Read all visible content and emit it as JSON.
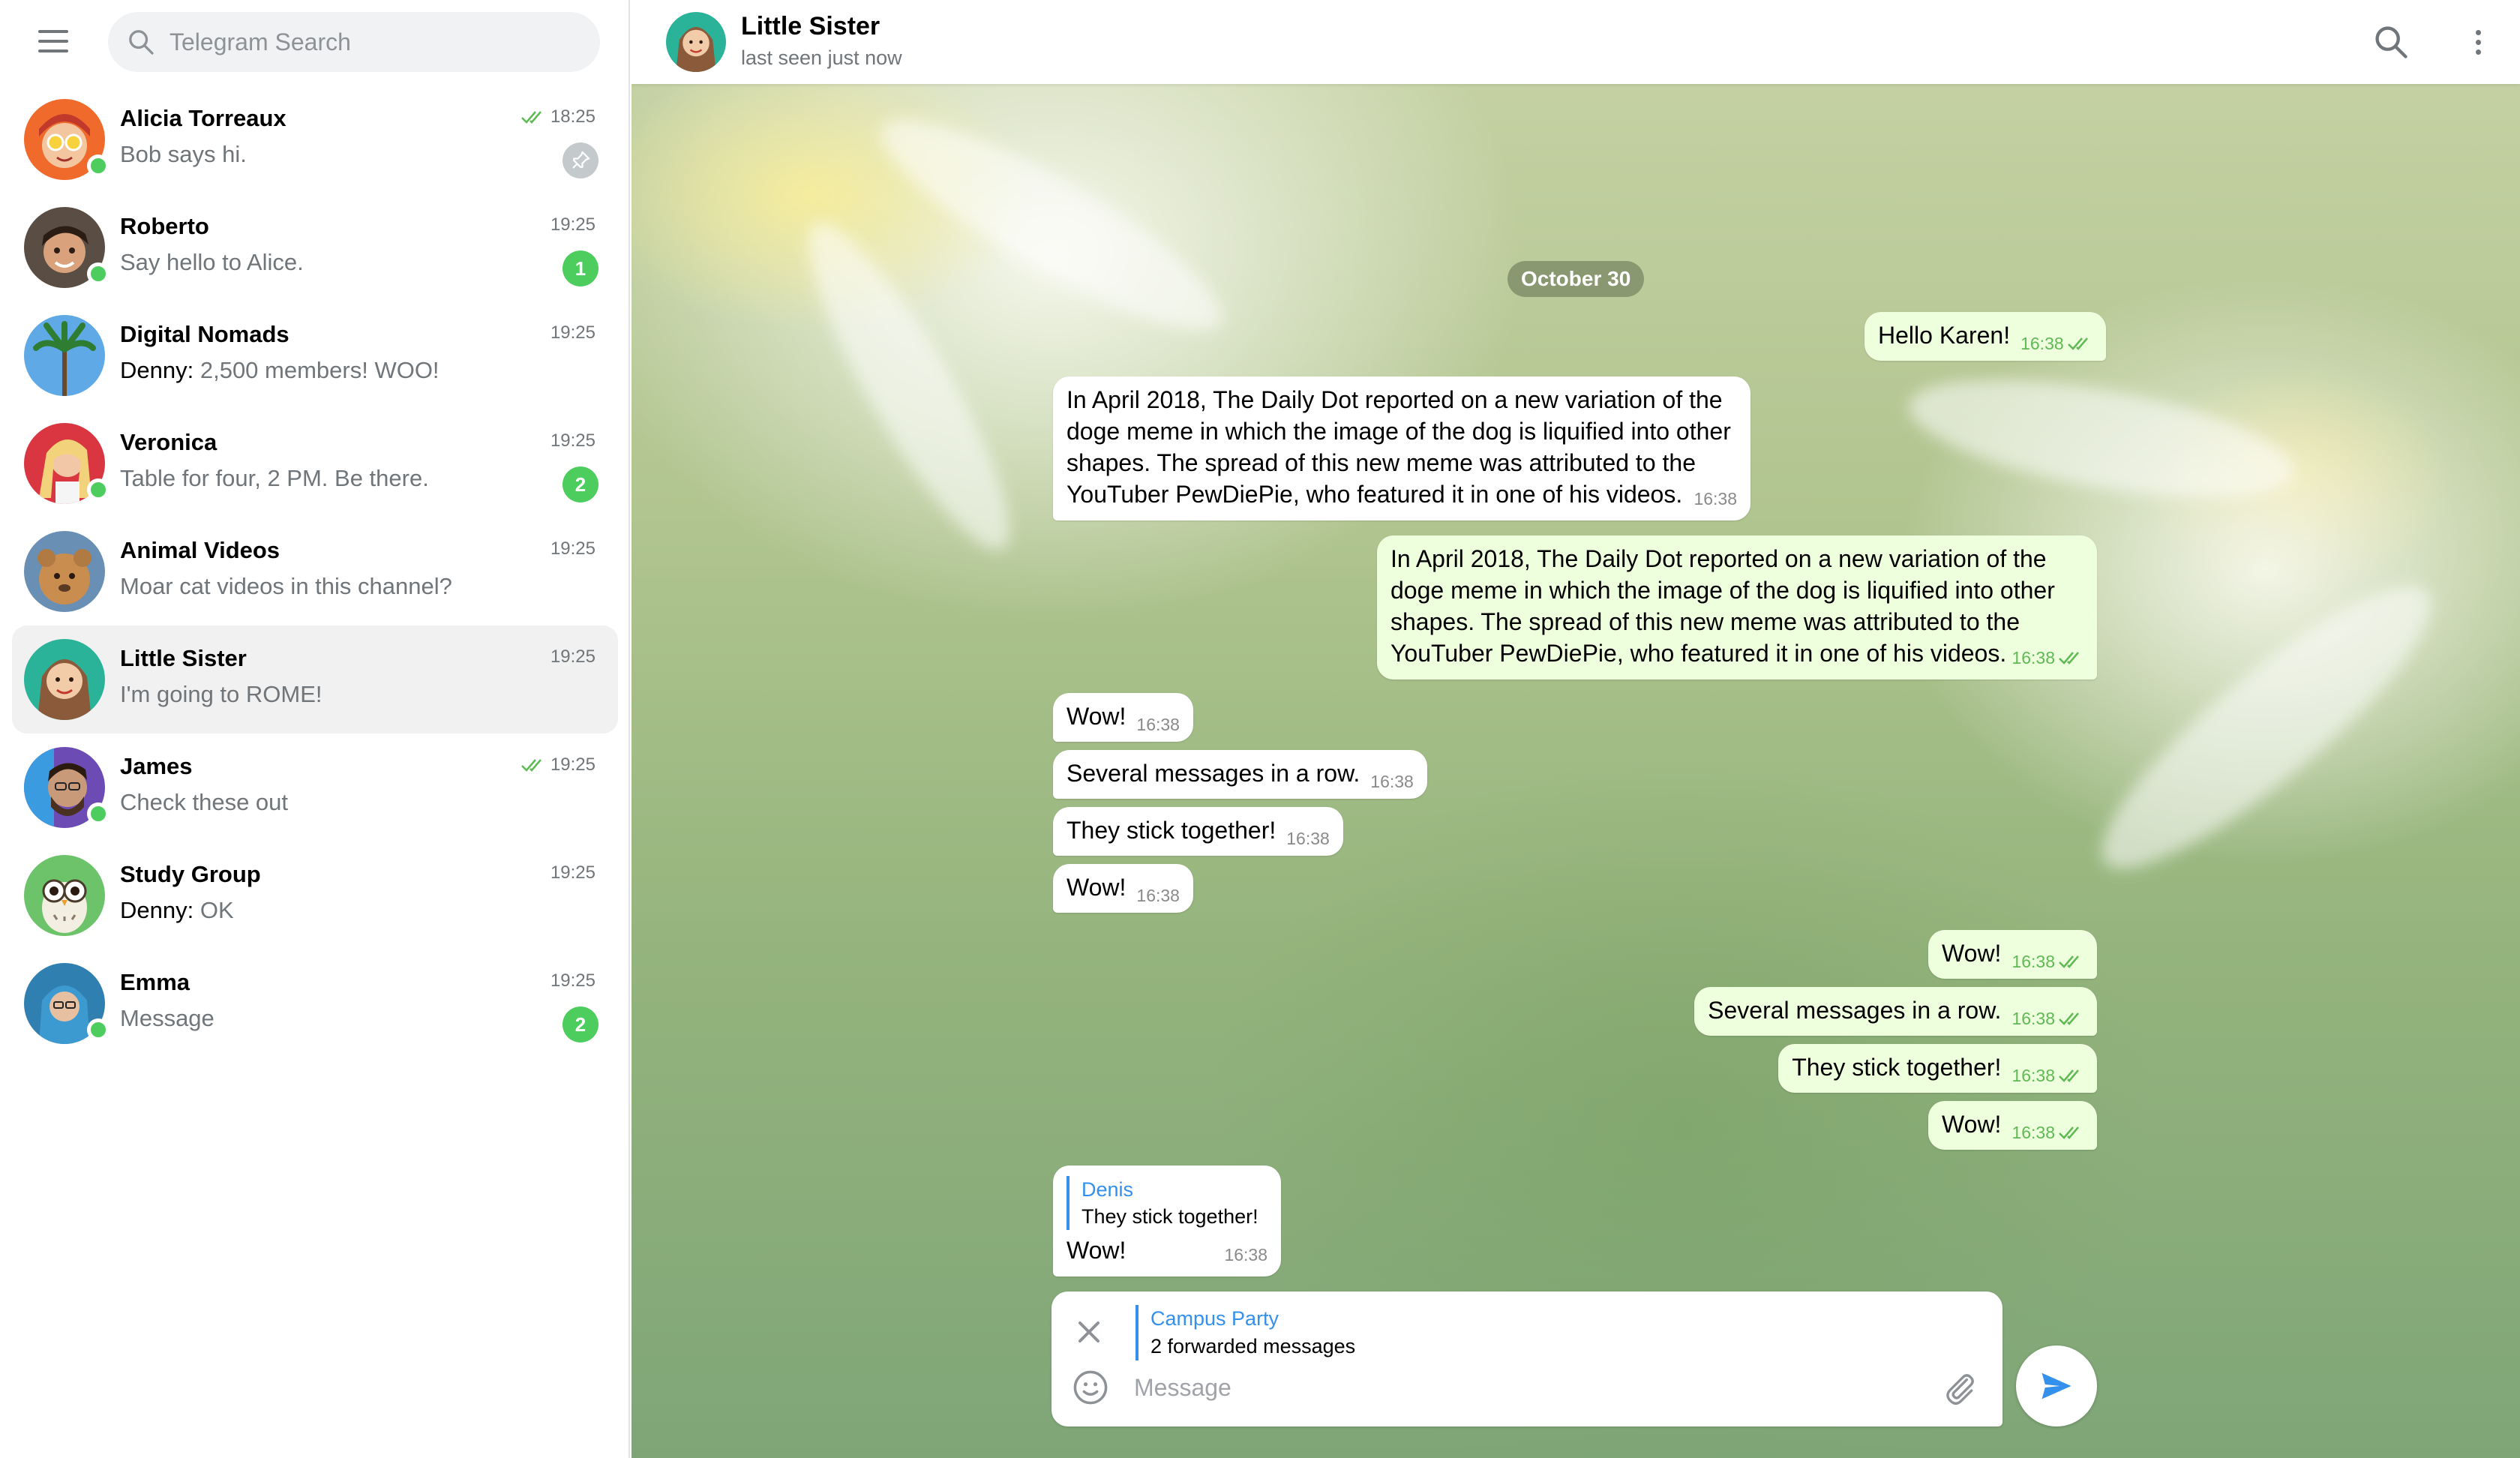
{
  "search": {
    "placeholder": "Telegram Search"
  },
  "chats": [
    {
      "name": "Alicia Torreaux",
      "sender": "",
      "preview": "Bob says hi.",
      "time": "18:25",
      "read": true,
      "pinned": true,
      "badge": "",
      "online": true
    },
    {
      "name": "Roberto",
      "sender": "",
      "preview": "Say hello to Alice.",
      "time": "19:25",
      "read": false,
      "pinned": false,
      "badge": "1",
      "online": true
    },
    {
      "name": "Digital Nomads",
      "sender": "Denny: ",
      "preview": "2,500 members! WOO!",
      "time": "19:25",
      "read": false,
      "pinned": false,
      "badge": "",
      "online": false
    },
    {
      "name": "Veronica",
      "sender": "",
      "preview": "Table for four, 2 PM. Be there.",
      "time": "19:25",
      "read": false,
      "pinned": false,
      "badge": "2",
      "online": true
    },
    {
      "name": "Animal Videos",
      "sender": "",
      "preview": "Moar cat videos in this channel?",
      "time": "19:25",
      "read": false,
      "pinned": false,
      "badge": "",
      "online": false
    },
    {
      "name": "Little Sister",
      "sender": "",
      "preview": "I'm going to ROME!",
      "time": "19:25",
      "read": false,
      "pinned": false,
      "badge": "",
      "online": false
    },
    {
      "name": "James",
      "sender": "",
      "preview": "Check these out",
      "time": "19:25",
      "read": true,
      "pinned": false,
      "badge": "",
      "online": true
    },
    {
      "name": "Study Group",
      "sender": "Denny: ",
      "preview": "OK",
      "time": "19:25",
      "read": false,
      "pinned": false,
      "badge": "",
      "online": false
    },
    {
      "name": "Emma",
      "sender": "",
      "preview": "Message",
      "time": "19:25",
      "read": false,
      "pinned": false,
      "badge": "2",
      "online": true
    }
  ],
  "header": {
    "title": "Little Sister",
    "status": "last seen just now"
  },
  "date_label": "October 30",
  "messages": [
    {
      "dir": "out",
      "text": "Hello Karen!",
      "time": "16:38"
    },
    {
      "dir": "in",
      "lines": [
        "In April 2018, The Daily Dot reported on a new variation of the",
        "doge meme in which the image of the dog is liquified into other",
        "shapes. The spread of this new meme was attributed to the",
        "YouTuber PewDiePie, who featured it in one of his videos."
      ],
      "time": "16:38"
    },
    {
      "dir": "out",
      "lines": [
        "In April 2018, The Daily Dot reported on a new variation of the",
        "doge meme in which the image of the dog is liquified into other",
        "shapes. The spread of this new meme was attributed to the",
        "YouTuber PewDiePie, who featured it in one of his videos."
      ],
      "time": "16:38"
    },
    {
      "dir": "in",
      "text": "Wow!",
      "time": "16:38"
    },
    {
      "dir": "in",
      "text": "Several messages in a row.",
      "time": "16:38"
    },
    {
      "dir": "in",
      "text": "They stick together!",
      "time": "16:38"
    },
    {
      "dir": "in",
      "text": "Wow!",
      "time": "16:38"
    },
    {
      "dir": "out",
      "text": "Wow!",
      "time": "16:38"
    },
    {
      "dir": "out",
      "text": "Several messages in a row.",
      "time": "16:38"
    },
    {
      "dir": "out",
      "text": "They stick together!",
      "time": "16:38"
    },
    {
      "dir": "out",
      "text": "Wow!",
      "time": "16:38"
    },
    {
      "dir": "in",
      "reply_name": "Denis",
      "reply_text": "They stick together!",
      "text": "Wow!",
      "time": "16:38"
    }
  ],
  "composer": {
    "forward_title": "Campus Party",
    "forward_sub": "2 forwarded messages",
    "placeholder": "Message"
  },
  "colors": {
    "accent": "#3390ec",
    "online": "#4dcd5e",
    "outgoing_bubble": "#eeffde",
    "read_check": "#5fb954"
  }
}
